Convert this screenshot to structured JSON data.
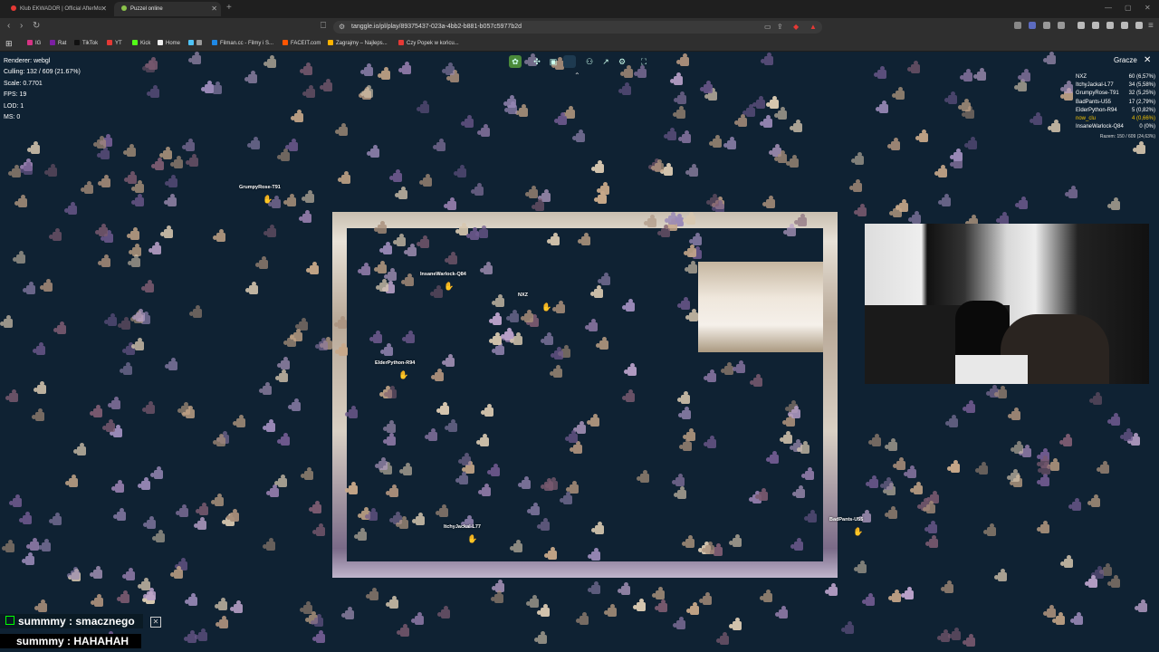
{
  "browser": {
    "tabs": [
      {
        "label": "Klub EKWADOR | Official AfterMo",
        "favicon_color": "#e53935"
      },
      {
        "label": "Puzzel online",
        "favicon_color": "#8bc34a"
      }
    ],
    "url": "tanggle.io/pl/play/89375437-023a-4bb2-b881-b057c5977b2d",
    "bookmarks": [
      {
        "label": "IG",
        "color": "#d63384"
      },
      {
        "label": "Rat",
        "color": "#7b1fa2"
      },
      {
        "label": "TikTok",
        "color": "#111111"
      },
      {
        "label": "YT",
        "color": "#e53935"
      },
      {
        "label": "Kick",
        "color": "#53fc18"
      },
      {
        "label": "Home",
        "color": "#eeeeee"
      },
      {
        "label": "Filman.cc - Filmy i S...",
        "color": "#1e88e5"
      },
      {
        "label": "FACEIT.com",
        "color": "#ff5500"
      },
      {
        "label": "Zagrajmy – Najleps...",
        "color": "#ffb300"
      },
      {
        "label": "Czy Popek w końcu...",
        "color": "#e53935"
      }
    ]
  },
  "game": {
    "stats": {
      "renderer": "Renderer: webgl",
      "culling": "Culling: 132 / 609 (21.67%)",
      "scale": "Scale: 0.7701",
      "fps": "FPS: 19",
      "lod": "LOD: 1",
      "ms": "MS: 0"
    },
    "toolbar_icons": [
      "puzzle-icon",
      "shuffle-icon",
      "image-icon",
      "square-icon",
      "players-icon",
      "share-icon",
      "settings-icon",
      "fullscreen-icon"
    ],
    "collapse_icon": "chevron-up-icon",
    "players_panel": {
      "title": "Gracze",
      "rows": [
        {
          "name": "NXZ",
          "score": "60 (6,57%)",
          "highlight": false
        },
        {
          "name": "ItchyJackal-L77",
          "score": "34 (5,58%)",
          "highlight": false
        },
        {
          "name": "GrumpyRose-T91",
          "score": "32 (5,25%)",
          "highlight": false
        },
        {
          "name": "BadPants-U55",
          "score": "17 (2,79%)",
          "highlight": false
        },
        {
          "name": "ElderPython-R94",
          "score": "5 (0,82%)",
          "highlight": false
        },
        {
          "name": "now_clu",
          "score": "4 (0,66%)",
          "highlight": true
        },
        {
          "name": "InsaneWarlock-Q84",
          "score": "0 (0%)",
          "highlight": false
        }
      ],
      "total": "Razem: 150 / 609 (24,63%)"
    },
    "cursors": [
      {
        "name": "GrumpyRose-T91",
        "color": "#f2c200"
      },
      {
        "name": "InsaneWarlock-Q84",
        "color": "#f2c200"
      },
      {
        "name": "NXZ",
        "color": "#f2c200"
      },
      {
        "name": "ElderPython-R94",
        "color": "#ff8a00"
      },
      {
        "name": "ItchyJackal-L77",
        "color": "#f2c200"
      },
      {
        "name": "BadPants-U55",
        "color": "#f2c200"
      }
    ]
  },
  "chat": [
    {
      "user": "summmy",
      "message": "smacznego"
    },
    {
      "user": "summmy",
      "message": "HAHAHAH"
    }
  ],
  "colors": {
    "background": "#0f2233",
    "piece_palette": [
      "#c9a98a",
      "#a88e7a",
      "#8f7aa8",
      "#6f5a8f",
      "#b8a0c8",
      "#d8c8b0",
      "#7a5a70",
      "#9a8ab8"
    ]
  }
}
